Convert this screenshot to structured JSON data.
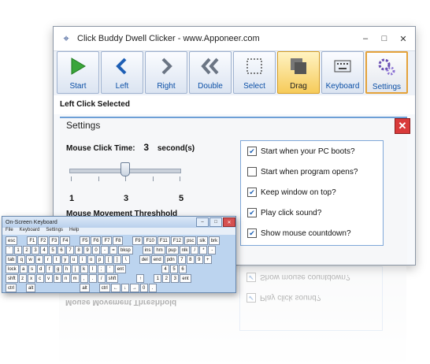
{
  "window": {
    "title": "Click Buddy Dwell Clicker - www.Apponeer.com",
    "controls": [
      "–",
      "□",
      "✕"
    ]
  },
  "toolbar": {
    "buttons": [
      {
        "label": "Start",
        "icon": "play-icon"
      },
      {
        "label": "Left",
        "icon": "chevron-left-icon"
      },
      {
        "label": "Right",
        "icon": "chevron-right-icon"
      },
      {
        "label": "Double",
        "icon": "double-chevron-icon"
      },
      {
        "label": "Select",
        "icon": "select-box-icon"
      },
      {
        "label": "Drag",
        "icon": "drag-icon"
      },
      {
        "label": "Keyboard",
        "icon": "keyboard-icon"
      },
      {
        "label": "Settings",
        "icon": "gears-icon"
      }
    ]
  },
  "status": "Left Click Selected",
  "settings": {
    "title": "Settings",
    "mouse_click_time_label": "Mouse Click Time:",
    "mouse_click_time_value": "3",
    "mouse_click_time_unit": "second(s)",
    "slider": {
      "min": "1",
      "mid": "3",
      "max": "5",
      "value": 3
    },
    "mouse_movement_label": "Mouse Movement Threshhold",
    "options": [
      {
        "label": "Start when your PC boots?",
        "checked": true
      },
      {
        "label": "Start when program opens?",
        "checked": false
      },
      {
        "label": "Keep window on top?",
        "checked": true
      },
      {
        "label": "Play click sound?",
        "checked": true
      },
      {
        "label": "Show mouse countdown?",
        "checked": true
      }
    ]
  },
  "reflection": {
    "options": [
      "Show mouse countdown?",
      "Play click sound?"
    ],
    "mouse_movement_label": "Mouse Movement Threshhold"
  },
  "osk": {
    "title": "On-Screen Keyboard",
    "menu": [
      "File",
      "Keyboard",
      "Settings",
      "Help"
    ],
    "controls": [
      "–",
      "□",
      "✕"
    ],
    "rows": [
      [
        "esc",
        "",
        "F1",
        "F2",
        "F3",
        "F4",
        "",
        "F5",
        "F6",
        "F7",
        "F8",
        "",
        "F9",
        "F10",
        "F11",
        "F12",
        "psc",
        "slk",
        "brk"
      ],
      [
        "`",
        "1",
        "2",
        "3",
        "4",
        "5",
        "6",
        "7",
        "8",
        "9",
        "0",
        "-",
        "=",
        "bksp",
        "",
        "ins",
        "hm",
        "pup",
        "nlk",
        "/",
        "*",
        "-"
      ],
      [
        "tab",
        "q",
        "w",
        "e",
        "r",
        "t",
        "y",
        "u",
        "i",
        "o",
        "p",
        "[",
        "]",
        "\\",
        "",
        "del",
        "end",
        "pdn",
        "7",
        "8",
        "9",
        "+"
      ],
      [
        "lock",
        "a",
        "s",
        "d",
        "f",
        "g",
        "h",
        "j",
        "k",
        "l",
        ";",
        "'",
        "ent",
        "",
        "",
        "",
        "",
        "4",
        "5",
        "6"
      ],
      [
        "shft",
        "z",
        "x",
        "c",
        "v",
        "b",
        "n",
        "m",
        ",",
        ".",
        "/",
        "shft",
        "",
        "",
        "↑",
        "",
        "1",
        "2",
        "3",
        "ent"
      ],
      [
        "ctrl",
        "",
        "alt",
        "",
        "",
        "",
        "",
        "",
        "alt",
        "",
        "ctrl",
        "←",
        "↓",
        "→",
        "0",
        "."
      ]
    ]
  }
}
